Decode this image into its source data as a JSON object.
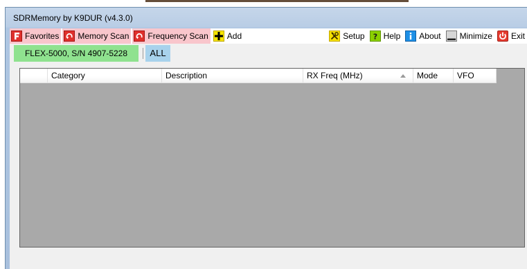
{
  "window": {
    "title": "SDRMemory by K9DUR (v4.3.0)"
  },
  "toolbar": {
    "favorites": {
      "label": "Favorites",
      "icon": "favorites-icon"
    },
    "memory_scan": {
      "label": "Memory Scan",
      "icon": "memory-scan-icon"
    },
    "frequency_scan": {
      "label": "Frequency Scan",
      "icon": "frequency-scan-icon"
    },
    "add": {
      "label": "Add",
      "icon": "plus-icon"
    },
    "setup": {
      "label": "Setup",
      "icon": "tools-icon"
    },
    "help": {
      "label": "Help",
      "icon": "question-icon"
    },
    "about": {
      "label": "About",
      "icon": "info-icon"
    },
    "minimize": {
      "label": "Minimize",
      "icon": "minimize-icon"
    },
    "exit": {
      "label": "Exit",
      "icon": "power-icon"
    }
  },
  "radios": {
    "radio1": "FLEX-5000, S/N 4907-5228",
    "all": "ALL"
  },
  "grid": {
    "columns": [
      "",
      "Category",
      "Description",
      "RX Freq (MHz)",
      "Mode",
      "VFO"
    ],
    "sorted_column": "RX Freq (MHz)",
    "sort_direction": "ascending",
    "rows": []
  },
  "colors": {
    "pink_button": "#f9c6cc",
    "active_radio": "#8fe28f",
    "all_tab": "#a8d2ec",
    "grid_background": "#a9a9a9"
  }
}
